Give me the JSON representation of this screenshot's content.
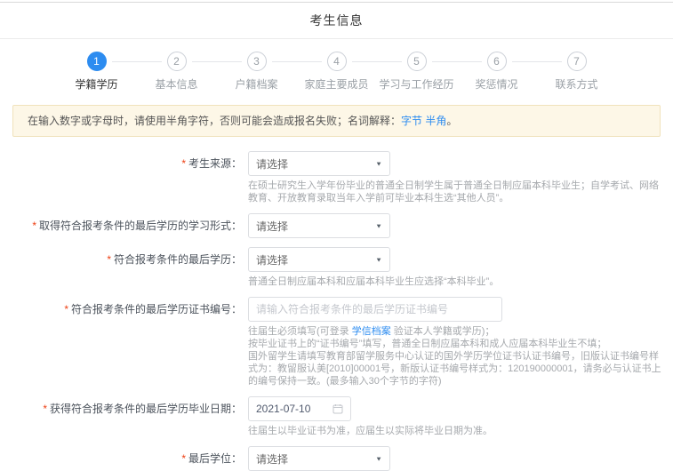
{
  "page": {
    "title": "考生信息"
  },
  "steps": {
    "items": [
      {
        "num": "1",
        "label": "学籍学历",
        "active": true
      },
      {
        "num": "2",
        "label": "基本信息",
        "active": false
      },
      {
        "num": "3",
        "label": "户籍档案",
        "active": false
      },
      {
        "num": "4",
        "label": "家庭主要成员",
        "active": false
      },
      {
        "num": "5",
        "label": "学习与工作经历",
        "active": false
      },
      {
        "num": "6",
        "label": "奖惩情况",
        "active": false
      },
      {
        "num": "7",
        "label": "联系方式",
        "active": false
      }
    ]
  },
  "notice": {
    "text_before": "在输入数字或字母时，请使用半角字符，否则可能会造成报名失败；名词解释：",
    "link1": "字节",
    "link2": "半角",
    "text_after": "。"
  },
  "form": {
    "required_mark": "*",
    "fields": [
      {
        "label": "考生来源：",
        "type": "select",
        "value": "请选择",
        "help": "在硕士研究生入学年份毕业的普通全日制学生属于普通全日制应届本科毕业生；自学考试、网络教育、开放教育录取当年入学前可毕业本科生选“其他人员”。"
      },
      {
        "label": "取得符合报考条件的最后学历的学习形式：",
        "type": "select",
        "value": "请选择"
      },
      {
        "label": "符合报考条件的最后学历：",
        "type": "select",
        "value": "请选择",
        "help": "普通全日制应届本科和应届本科毕业生应选择“本科毕业”。"
      },
      {
        "label": "符合报考条件的最后学历证书编号：",
        "type": "input",
        "placeholder": "请输入符合报考条件的最后学历证书编号",
        "help_line1_prefix": "往届生必须填写(可登录 ",
        "help_line1_link": "学信档案",
        "help_line1_suffix": " 验证本人学籍或学历)；",
        "help_line2": "按毕业证书上的“证书编号”填写，普通全日制应届本科和成人应届本科毕业生不填；",
        "help_line3": "国外留学生请填写教育部留学服务中心认证的国外学历学位证书认证书编号，旧版认证书编号样式为：教留服认美[2010]00001号，新版认证书编号样式为：120190000001，请务必与认证书上的编号保持一致。(最多输入30个字节的字符)"
      },
      {
        "label": "获得符合报考条件的最后学历毕业日期：",
        "type": "date",
        "value": "2021-07-10",
        "help": "往届生以毕业证书为准，应届生以实际将毕业日期为准。"
      },
      {
        "label": "最后学位：",
        "type": "select",
        "value": "请选择"
      }
    ]
  },
  "icons": {
    "chevron_down": "▼"
  },
  "colors": {
    "accent_blue": "#2d8cf0",
    "required_red": "#ed4014",
    "banner_bg": "#fdf7e7",
    "banner_border": "#f0e2bc"
  }
}
